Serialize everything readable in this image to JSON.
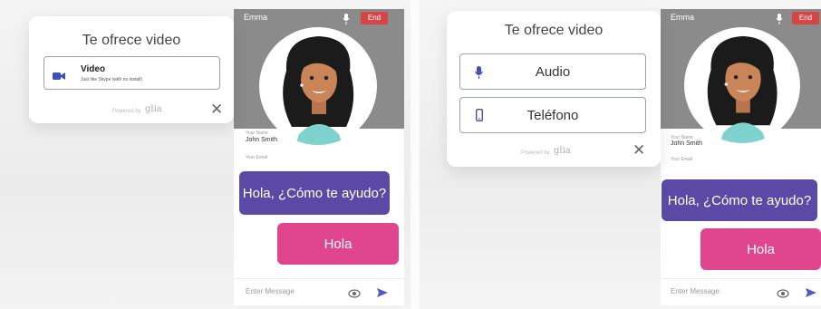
{
  "colors": {
    "agent_bubble": "#5a4aa6",
    "user_bubble": "#e0468d",
    "header": "#8b8b8b",
    "end": "#d64545",
    "option_icon": "#3d4fb8"
  },
  "left": {
    "offer": {
      "title": "Te ofrece video",
      "option": {
        "icon": "video-camera-icon",
        "label": "Video",
        "desc": "Just like Skype (with no install)"
      },
      "powered": "Powered by",
      "logo": "glia",
      "close": "✕"
    },
    "chat": {
      "agent_name": "Emma",
      "end_label": "End",
      "name_label": "Your Name",
      "name_value": "John Smith",
      "email_label": "Your Email",
      "agent_message": "Hola, ¿Cómo te ayudo?",
      "user_message": "Hola",
      "input_placeholder": "Enter Message"
    }
  },
  "right": {
    "offer": {
      "title": "Te ofrece video",
      "options": [
        {
          "icon": "microphone-icon",
          "label": "Audio"
        },
        {
          "icon": "phone-icon",
          "label": "Teléfono"
        }
      ],
      "powered": "Powered by",
      "logo": "glia",
      "close": "✕"
    },
    "chat": {
      "agent_name": "Emma",
      "end_label": "End",
      "name_label": "Your Name",
      "name_value": "John Smith",
      "email_label": "Your Email",
      "agent_message": "Hola, ¿Cómo te ayudo?",
      "user_message": "Hola",
      "input_placeholder": "Enter Message"
    }
  }
}
